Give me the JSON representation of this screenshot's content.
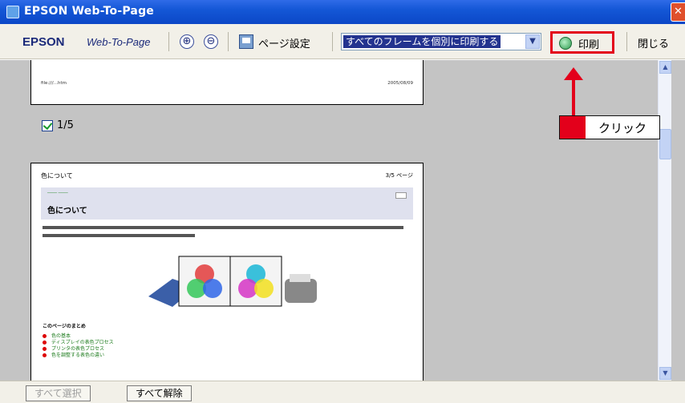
{
  "window": {
    "title": "EPSON Web-To-Page",
    "close_glyph": "✕"
  },
  "toolbar": {
    "brand": "EPSON",
    "product": "Web-To-Page",
    "zoom_in_icon": "zoom-in-icon",
    "zoom_out_icon": "zoom-out-icon",
    "zoom_in_glyph": "⊕",
    "zoom_out_glyph": "⊖",
    "page_setup_label": "ページ設定",
    "frame_select_value": "すべてのフレームを個別に印刷する",
    "print_label": "印刷",
    "close_label": "閉じる"
  },
  "page1": {
    "url": "file:///...htm",
    "date": "2005/08/09"
  },
  "page_check": {
    "label": "1/5",
    "checked": true
  },
  "page2": {
    "header_left": "色について",
    "header_right": "3/5 ページ",
    "title": "色について",
    "list_title": "このページのまとめ",
    "list_items": [
      "色の基本",
      "ディスプレイの表色プロセス",
      "プリンタの表色プロセス",
      "色を調整する表色の違い"
    ]
  },
  "annotation": {
    "callout_text": "クリック"
  },
  "bottom": {
    "select_all": "すべて選択",
    "deselect_all": "すべて解除"
  },
  "colors": {
    "accent_red": "#e3001b",
    "title_blue": "#0b47c7",
    "select_blue": "#23338f"
  }
}
